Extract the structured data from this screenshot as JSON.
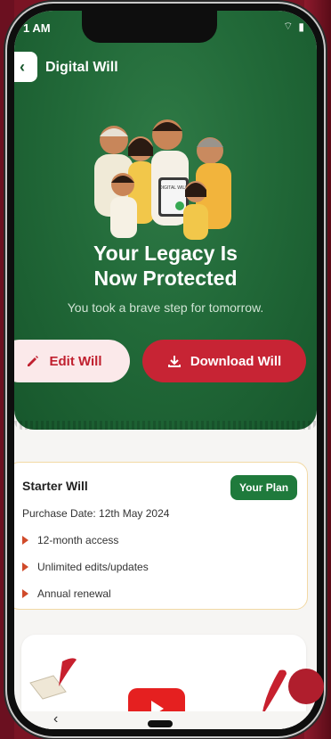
{
  "status_bar": {
    "time": "1 AM",
    "signal": "⌔",
    "battery": "▮"
  },
  "header": {
    "back_icon": "chevron-left-icon",
    "back_glyph": "‹",
    "title": "Digital Will"
  },
  "hero": {
    "illustration": "family-with-digital-will-illustration",
    "tablet_text": "DIGITAL WILL",
    "headline_line1": "Your Legacy Is",
    "headline_line2": "Now Protected",
    "subline": "You took a brave step for tomorrow."
  },
  "actions": {
    "edit_label": "Edit Will",
    "edit_icon": "pencil-icon",
    "download_label": "Download Will",
    "download_icon": "download-icon"
  },
  "plan_card": {
    "name": "Starter Will",
    "badge": "Your Plan",
    "purchase_date": "Purchase Date: 12th May 2024",
    "features": [
      "12-month access",
      "Unlimited edits/updates",
      "Annual renewal"
    ]
  },
  "colors": {
    "hero_green": "#226a39",
    "accent_red": "#c72434",
    "badge_green": "#1f7a3c"
  }
}
